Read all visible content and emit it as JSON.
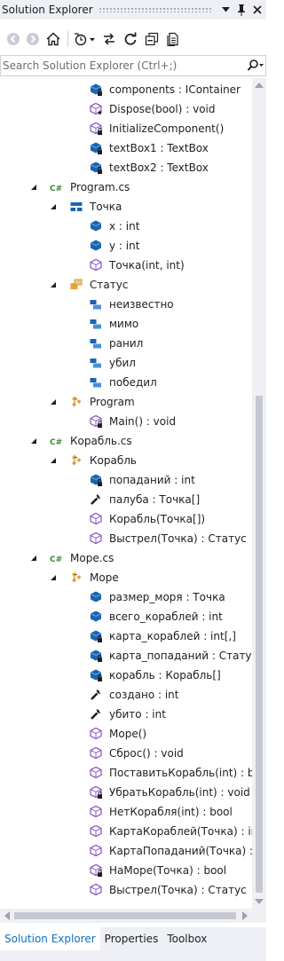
{
  "title": "Solution Explorer",
  "search": {
    "placeholder": "Search Solution Explorer (Ctrl+;)"
  },
  "tree": [
    {
      "depth": 3,
      "icon": "field-private",
      "label": "components : IContainer"
    },
    {
      "depth": 3,
      "icon": "method-protected",
      "label": "Dispose(bool) : void"
    },
    {
      "depth": 3,
      "icon": "method-private",
      "label": "InitializeComponent()"
    },
    {
      "depth": 3,
      "icon": "field-private",
      "label": "textBox1 : TextBox"
    },
    {
      "depth": 3,
      "icon": "field-private",
      "label": "textBox2 : TextBox"
    },
    {
      "depth": 1,
      "expand": "open",
      "icon": "csharp-file",
      "label": "Program.cs"
    },
    {
      "depth": 2,
      "expand": "open",
      "icon": "struct",
      "label": "Точка"
    },
    {
      "depth": 3,
      "icon": "field",
      "label": "x : int"
    },
    {
      "depth": 3,
      "icon": "field",
      "label": "y : int"
    },
    {
      "depth": 3,
      "icon": "method",
      "label": "Точка(int, int)"
    },
    {
      "depth": 2,
      "expand": "open",
      "icon": "enum",
      "label": "Статус"
    },
    {
      "depth": 3,
      "icon": "enum-item",
      "label": "неизвестно"
    },
    {
      "depth": 3,
      "icon": "enum-item",
      "label": "мимо"
    },
    {
      "depth": 3,
      "icon": "enum-item",
      "label": "ранил"
    },
    {
      "depth": 3,
      "icon": "enum-item",
      "label": "убил"
    },
    {
      "depth": 3,
      "icon": "enum-item",
      "label": "победил"
    },
    {
      "depth": 2,
      "expand": "open",
      "icon": "class-static",
      "label": "Program"
    },
    {
      "depth": 3,
      "icon": "method-private",
      "label": "Main() : void"
    },
    {
      "depth": 1,
      "expand": "open",
      "icon": "csharp-file",
      "label": "Корабль.cs"
    },
    {
      "depth": 2,
      "expand": "open",
      "icon": "class",
      "label": "Корабль"
    },
    {
      "depth": 3,
      "icon": "field-private",
      "label": "попаданий : int"
    },
    {
      "depth": 3,
      "icon": "property",
      "label": "палуба : Точка[]"
    },
    {
      "depth": 3,
      "icon": "method",
      "label": "Корабль(Точка[])"
    },
    {
      "depth": 3,
      "icon": "method",
      "label": "Выстрел(Точка) : Статус"
    },
    {
      "depth": 1,
      "expand": "open",
      "icon": "csharp-file",
      "label": "Море.cs"
    },
    {
      "depth": 2,
      "expand": "open",
      "icon": "class",
      "label": "Море"
    },
    {
      "depth": 3,
      "icon": "field",
      "label": "размер_моря : Точка"
    },
    {
      "depth": 3,
      "icon": "field",
      "label": "всего_кораблей : int"
    },
    {
      "depth": 3,
      "icon": "field-private",
      "label": "карта_кораблей : int[,]"
    },
    {
      "depth": 3,
      "icon": "field-private",
      "label": "карта_попаданий : Статус[,]"
    },
    {
      "depth": 3,
      "icon": "field-private",
      "label": "корабль : Корабль[]"
    },
    {
      "depth": 3,
      "icon": "property",
      "label": "создано : int"
    },
    {
      "depth": 3,
      "icon": "property",
      "label": "убито : int"
    },
    {
      "depth": 3,
      "icon": "method",
      "label": "Море()"
    },
    {
      "depth": 3,
      "icon": "method",
      "label": "Сброс() : void"
    },
    {
      "depth": 3,
      "icon": "method",
      "label": "ПоставитьКорабль(int) : bool"
    },
    {
      "depth": 3,
      "icon": "method-private",
      "label": "УбратьКорабль(int) : void"
    },
    {
      "depth": 3,
      "icon": "method",
      "label": "НетКорабля(int) : bool"
    },
    {
      "depth": 3,
      "icon": "method",
      "label": "КартаКораблей(Точка) : int"
    },
    {
      "depth": 3,
      "icon": "method",
      "label": "КартаПопаданий(Точка) : Статус"
    },
    {
      "depth": 3,
      "icon": "method-private",
      "label": "НаМоре(Точка) : bool"
    },
    {
      "depth": 3,
      "icon": "method",
      "label": "Выстрел(Точка) : Статус"
    }
  ],
  "tabs": [
    {
      "label": "Solution Explorer",
      "active": true
    },
    {
      "label": "Properties",
      "active": false
    },
    {
      "label": "Toolbox",
      "active": false
    }
  ]
}
